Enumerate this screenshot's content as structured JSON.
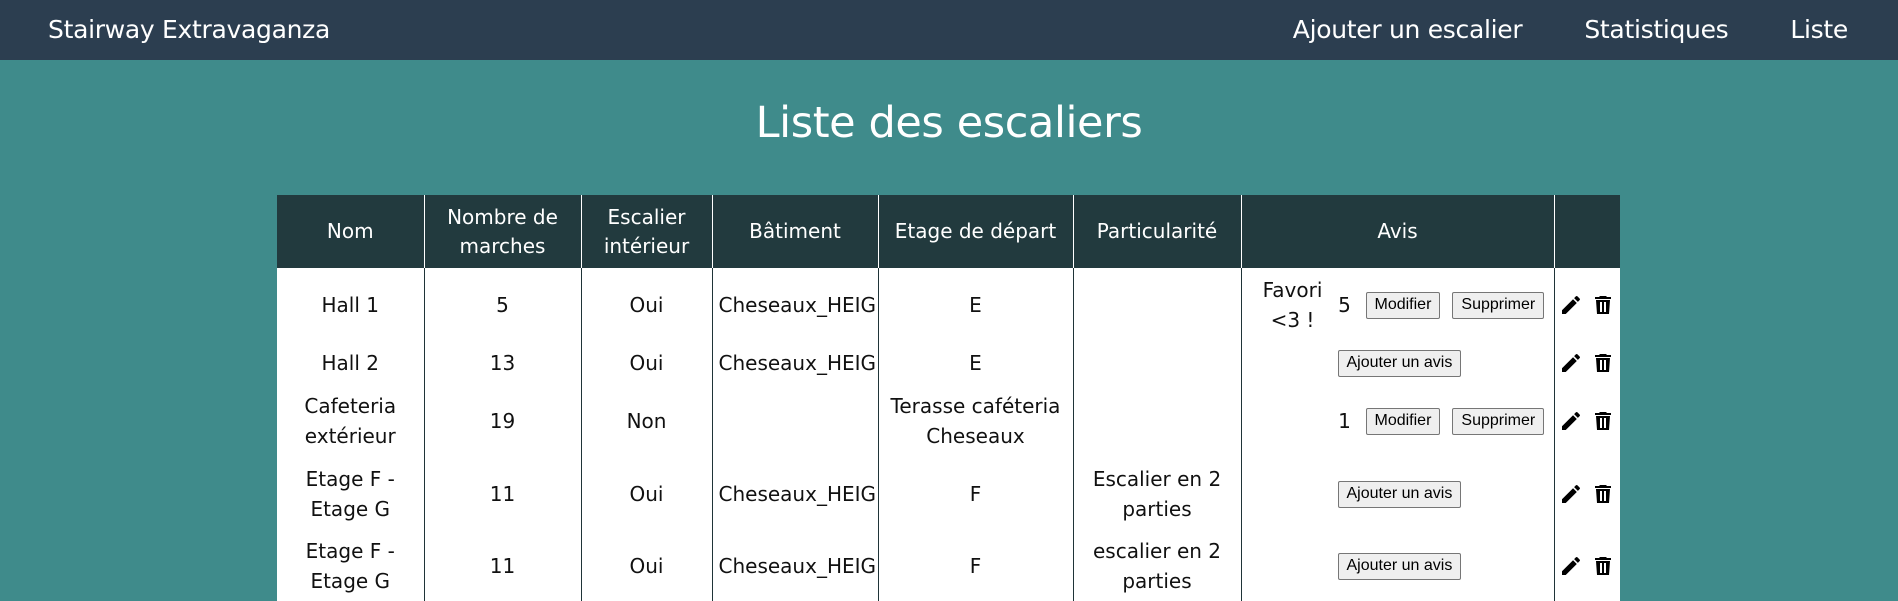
{
  "navbar": {
    "brand": "Stairway Extravaganza",
    "links": [
      "Ajouter un escalier",
      "Statistiques",
      "Liste"
    ]
  },
  "page": {
    "title": "Liste des escaliers"
  },
  "table": {
    "headers": [
      "Nom",
      "Nombre de marches",
      "Escalier intérieur",
      "Bâtiment",
      "Etage de départ",
      "Particularité",
      "Avis",
      ""
    ],
    "rows": [
      {
        "nom": "Hall 1",
        "marches": "5",
        "interieur": "Oui",
        "batiment": "Cheseaux_HEIG",
        "etage": "E",
        "particularite": "",
        "favori": "Favori <3 !",
        "note": "5",
        "modifier": "Modifier",
        "supprimer": "Supprimer",
        "ajouter": ""
      },
      {
        "nom": "Hall 2",
        "marches": "13",
        "interieur": "Oui",
        "batiment": "Cheseaux_HEIG",
        "etage": "E",
        "particularite": "",
        "favori": "",
        "note": "",
        "modifier": "",
        "supprimer": "",
        "ajouter": "Ajouter un avis"
      },
      {
        "nom": "Cafeteria extérieur",
        "marches": "19",
        "interieur": "Non",
        "batiment": "",
        "etage": "Terasse caféteria Cheseaux",
        "particularite": "",
        "favori": "",
        "note": "1",
        "modifier": "Modifier",
        "supprimer": "Supprimer",
        "ajouter": ""
      },
      {
        "nom": "Etage F - Etage G",
        "marches": "11",
        "interieur": "Oui",
        "batiment": "Cheseaux_HEIG",
        "etage": "F",
        "particularite": "Escalier en 2 parties",
        "favori": "",
        "note": "",
        "modifier": "",
        "supprimer": "",
        "ajouter": "Ajouter un avis"
      },
      {
        "nom": "Etage F - Etage G",
        "marches": "11",
        "interieur": "Oui",
        "batiment": "Cheseaux_HEIG",
        "etage": "F",
        "particularite": "escalier en 2 parties",
        "favori": "",
        "note": "",
        "modifier": "",
        "supprimer": "",
        "ajouter": "Ajouter un avis"
      }
    ]
  },
  "icons": {
    "edit": "pencil-icon",
    "delete": "trash-icon"
  },
  "colors": {
    "background": "#3f8b8b",
    "navbar": "#2c3e50",
    "table_header": "#223a3e"
  }
}
